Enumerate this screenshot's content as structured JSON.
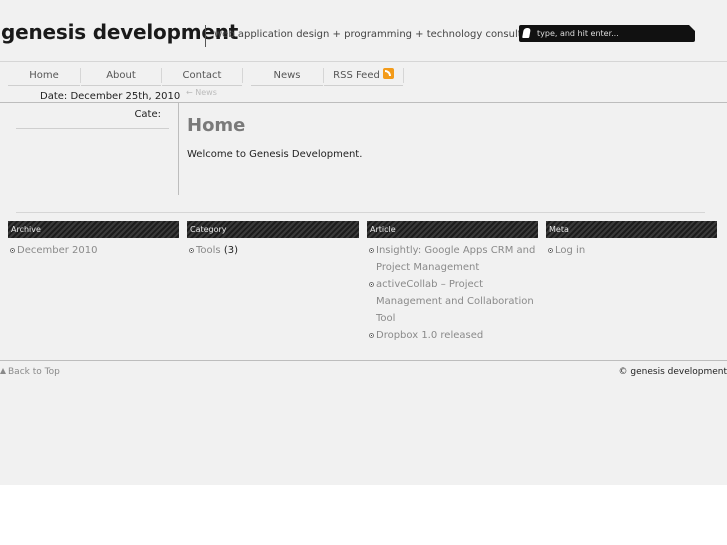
{
  "brand": {
    "name": "genesis development",
    "tagline": "web application design + programming + technology consulting"
  },
  "search": {
    "placeholder": "type, and hit enter..."
  },
  "nav": {
    "items": [
      {
        "label": "Home"
      },
      {
        "label": "About"
      },
      {
        "label": "Contact"
      },
      {
        "label": "News"
      },
      {
        "label": "RSS Feed",
        "icon": "rss-icon"
      }
    ]
  },
  "post": {
    "date": "Date: December 25th, 2010",
    "category_label": "Cate:",
    "breadcrumb": "← News",
    "title": "Home",
    "body": "Welcome to Genesis Development."
  },
  "widgets": {
    "archive": {
      "title": "Archive",
      "items": [
        {
          "label": "December 2010"
        }
      ]
    },
    "category": {
      "title": "Category",
      "items": [
        {
          "label": "Tools",
          "count": "(3)"
        }
      ]
    },
    "article": {
      "title": "Article",
      "items": [
        {
          "label": "Insightly: Google Apps CRM and Project Management"
        },
        {
          "label": "activeCollab – Project Management and Collaboration Tool"
        },
        {
          "label": "Dropbox 1.0 released"
        }
      ]
    },
    "meta": {
      "title": "Meta",
      "items": [
        {
          "label": "Log in"
        }
      ]
    }
  },
  "footer": {
    "back_to_top": "Back to Top",
    "copyright": "© genesis development"
  },
  "colors": {
    "background": "#f1f1f1",
    "widget_header": "#1c1c1c",
    "link": "#8a8a8a",
    "rss": "#f39b1a"
  }
}
